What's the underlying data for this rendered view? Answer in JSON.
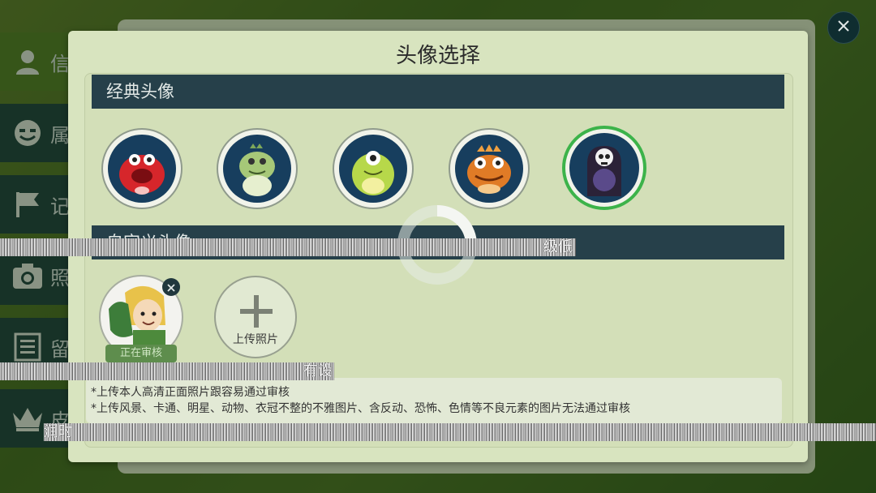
{
  "side_menu": {
    "items": [
      {
        "icon": "user-icon",
        "label": "信"
      },
      {
        "icon": "smiley-icon",
        "label": "属"
      },
      {
        "icon": "flag-icon",
        "label": "记"
      },
      {
        "icon": "camera-icon",
        "label": "照"
      },
      {
        "icon": "document-icon",
        "label": "留"
      },
      {
        "icon": "crown-icon",
        "label": "皮"
      }
    ]
  },
  "modal": {
    "title": "头像选择",
    "classic_section": "经典头像",
    "custom_section": "自定义头像",
    "classic_avatars": [
      {
        "name": "red-monster-avatar",
        "color": "#d6262b"
      },
      {
        "name": "green-dino-avatar",
        "color": "#a6c878"
      },
      {
        "name": "green-cyclops-avatar",
        "color": "#b7d84a"
      },
      {
        "name": "orange-toad-avatar",
        "color": "#e07b26"
      },
      {
        "name": "skull-ghost-avatar",
        "color": "#3a2f4e"
      }
    ],
    "selected_index": 4,
    "custom": {
      "review_label": "正在审核",
      "upload_label": "上传照片"
    },
    "notes": [
      "*上传本人高清正面照片跟容易通过审核",
      "*上传风景、卡通、明星、动物、衣冠不整的不雅图片、含反动、恐怖、色情等不良元素的图片无法通过审核"
    ]
  },
  "overlay_text": {
    "line1": "级低",
    "line2": "有设",
    "line3": "润时"
  },
  "colors": {
    "section_bar": "#26404a",
    "modal_bg": "#d8e4bf",
    "selected_ring": "#3cb34a"
  }
}
